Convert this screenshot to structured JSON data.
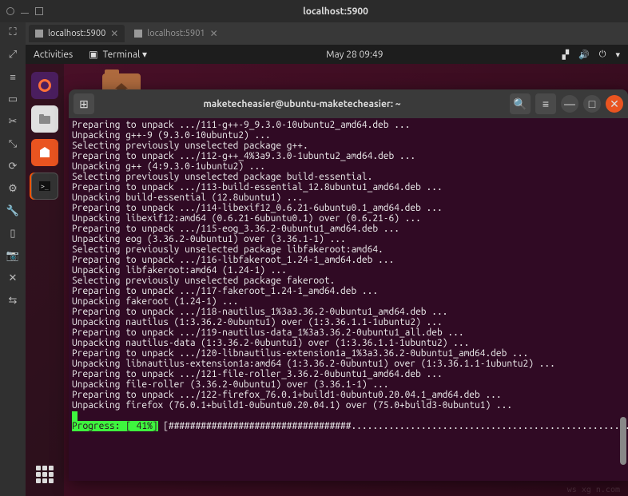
{
  "outer": {
    "title": "localhost:5900"
  },
  "tabs": [
    {
      "label": "localhost:5900",
      "active": true
    },
    {
      "label": "localhost:5901",
      "active": false
    }
  ],
  "gnome": {
    "activities": "Activities",
    "app_menu": "Terminal ▾",
    "datetime": "May 28  09:49"
  },
  "terminal": {
    "title": "maketecheasier@ubuntu-maketecheasier: ~",
    "lines": [
      "Preparing to unpack .../111-g++-9_9.3.0-10ubuntu2_amd64.deb ...",
      "Unpacking g++-9 (9.3.0-10ubuntu2) ...",
      "Selecting previously unselected package g++.",
      "Preparing to unpack .../112-g++_4%3a9.3.0-1ubuntu2_amd64.deb ...",
      "Unpacking g++ (4:9.3.0-1ubuntu2) ...",
      "Selecting previously unselected package build-essential.",
      "Preparing to unpack .../113-build-essential_12.8ubuntu1_amd64.deb ...",
      "Unpacking build-essential (12.8ubuntu1) ...",
      "Preparing to unpack .../114-libexif12_0.6.21-6ubuntu0.1_amd64.deb ...",
      "Unpacking libexif12:amd64 (0.6.21-6ubuntu0.1) over (0.6.21-6) ...",
      "Preparing to unpack .../115-eog_3.36.2-0ubuntu1_amd64.deb ...",
      "Unpacking eog (3.36.2-0ubuntu1) over (3.36.1-1) ...",
      "Selecting previously unselected package libfakeroot:amd64.",
      "Preparing to unpack .../116-libfakeroot_1.24-1_amd64.deb ...",
      "Unpacking libfakeroot:amd64 (1.24-1) ...",
      "Selecting previously unselected package fakeroot.",
      "Preparing to unpack .../117-fakeroot_1.24-1_amd64.deb ...",
      "Unpacking fakeroot (1.24-1) ...",
      "Preparing to unpack .../118-nautilus_1%3a3.36.2-0ubuntu1_amd64.deb ...",
      "Unpacking nautilus (1:3.36.2-0ubuntu1) over (1:3.36.1.1-1ubuntu2) ...",
      "Preparing to unpack .../119-nautilus-data_1%3a3.36.2-0ubuntu1_all.deb ...",
      "Unpacking nautilus-data (1:3.36.2-0ubuntu1) over (1:3.36.1.1-1ubuntu2) ...",
      "Preparing to unpack .../120-libnautilus-extension1a_1%3a3.36.2-0ubuntu1_amd64.deb ...",
      "Unpacking libnautilus-extension1a:amd64 (1:3.36.2-0ubuntu1) over (1:3.36.1.1-1ubuntu2) ...",
      "Preparing to unpack .../121-file-roller_3.36.2-0ubuntu1_amd64.deb ...",
      "Unpacking file-roller (3.36.2-0ubuntu1) over (3.36.1-1) ...",
      "Preparing to unpack .../122-firefox_76.0.1+build1-0ubuntu0.20.04.1_amd64.deb ...",
      "Unpacking firefox (76.0.1+build1-0ubuntu0.20.04.1) over (75.0+build3-0ubuntu1) ..."
    ],
    "progress": {
      "label": "Progress: [ 41%]",
      "bar": " [##################################......................................................] ",
      "percent": 41
    }
  },
  "footer": "ws xg n.com"
}
